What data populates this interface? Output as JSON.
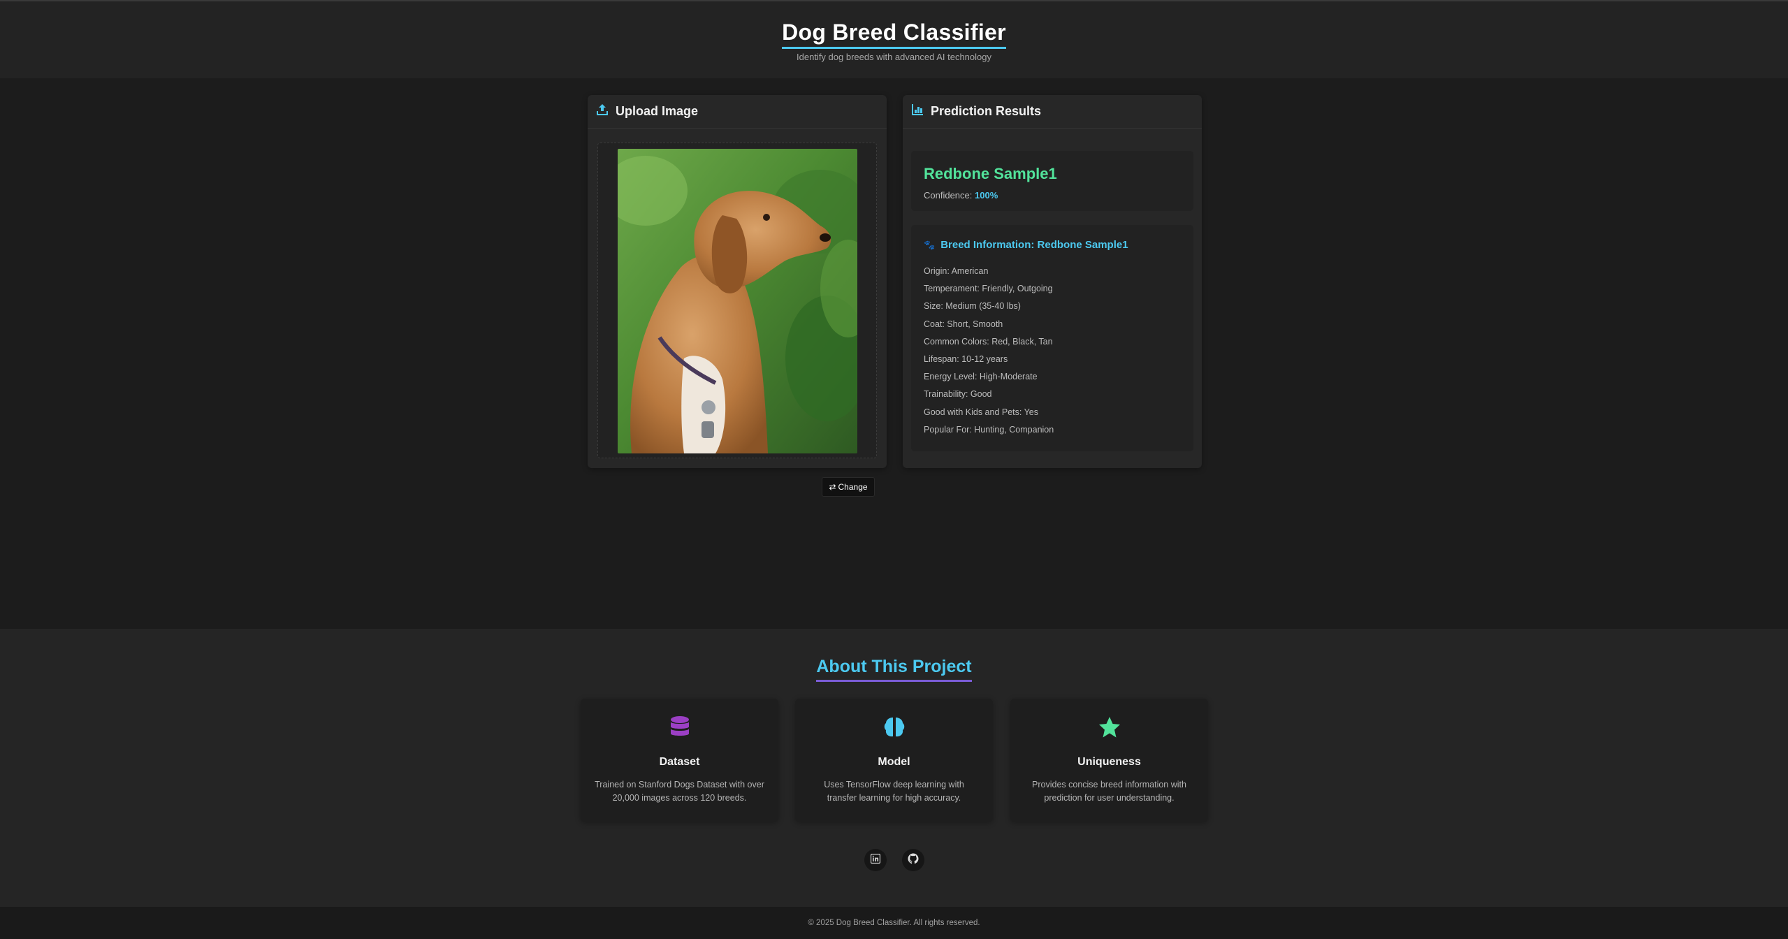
{
  "header": {
    "title": "Dog Breed Classifier",
    "subtitle": "Identify dog breeds with advanced AI technology"
  },
  "upload": {
    "title": "Upload Image",
    "change_label": "Change",
    "icon": "upload-icon"
  },
  "results": {
    "title": "Prediction Results",
    "icon": "chart-icon",
    "breed_name": "Redbone Sample1",
    "confidence_label": "Confidence:",
    "confidence_value": "100%",
    "info_title": "Breed Information: Redbone Sample1",
    "info_items": [
      "Origin: American",
      "Temperament: Friendly, Outgoing",
      "Size: Medium (35-40 lbs)",
      "Coat: Short, Smooth",
      "Common Colors: Red, Black, Tan",
      "Lifespan: 10-12 years",
      "Energy Level: High-Moderate",
      "Trainability: Good",
      "Good with Kids and Pets: Yes",
      "Popular For: Hunting, Companion"
    ]
  },
  "about": {
    "title": "About This Project",
    "cards": [
      {
        "title": "Dataset",
        "desc": "Trained on Stanford Dogs Dataset with over 20,000 images across 120 breeds.",
        "icon": "database-icon",
        "color": "#9b3fc4"
      },
      {
        "title": "Model",
        "desc": "Uses TensorFlow deep learning with transfer learning for high accuracy.",
        "icon": "brain-icon",
        "color": "#4cc9f0"
      },
      {
        "title": "Uniqueness",
        "desc": "Provides concise breed information with prediction for user understanding.",
        "icon": "star-icon",
        "color": "#52e39b"
      }
    ]
  },
  "social": [
    {
      "icon": "linkedin-icon"
    },
    {
      "icon": "github-icon"
    }
  ],
  "footer": {
    "text": "© 2025 Dog Breed Classifier. All rights reserved."
  },
  "colors": {
    "accent": "#4cc9f0",
    "success": "#52e39b",
    "purple": "#7b5cd6",
    "background": "#1c1c1c"
  }
}
